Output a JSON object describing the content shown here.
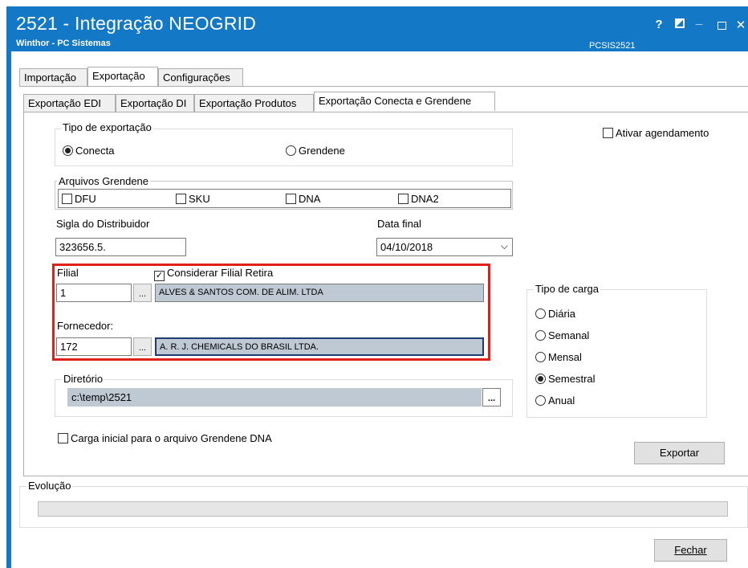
{
  "window": {
    "title": "2521 - Integração NEOGRID",
    "subtitle": "Winthor - PC Sistemas",
    "code": "PCSIS2521",
    "help_label": "?"
  },
  "tabs_main": [
    "Importação",
    "Exportação",
    "Configurações"
  ],
  "tabs_export": [
    "Exportação EDI",
    "Exportação DI",
    "Exportação Produtos",
    "Exportação Conecta e Grendene"
  ],
  "tipo_exportacao": {
    "label": "Tipo de exportação",
    "options": [
      "Conecta",
      "Grendene"
    ],
    "selected": "Conecta"
  },
  "ativar_agendamento": {
    "label": "Ativar agendamento",
    "checked": false
  },
  "arquivos_grendene": {
    "label": "Arquivos Grendene",
    "items": [
      {
        "label": "DFU",
        "checked": false
      },
      {
        "label": "SKU",
        "checked": false
      },
      {
        "label": "DNA",
        "checked": false
      },
      {
        "label": "DNA2",
        "checked": false
      }
    ]
  },
  "sigla_distribuidor": {
    "label": "Sigla do Distribuidor",
    "value": "323656.5."
  },
  "data_final": {
    "label": "Data final",
    "value": "04/10/2018"
  },
  "filial": {
    "label": "Filial",
    "code": "1",
    "name": "ALVES & SANTOS COM. DE ALIM. LTDA",
    "considerar_label": "Considerar Filial Retira",
    "considerar_checked": true
  },
  "fornecedor": {
    "label": "Fornecedor:",
    "code": "172",
    "name": "A. R. J. CHEMICALS DO BRASIL LTDA."
  },
  "lookup_button_label": "...",
  "tipo_carga": {
    "label": "Tipo de carga",
    "options": [
      "Diária",
      "Semanal",
      "Mensal",
      "Semestral",
      "Anual"
    ],
    "selected": "Semestral"
  },
  "diretorio": {
    "label": "Diretório",
    "value": "c:\\temp\\2521",
    "browse_label": "..."
  },
  "carga_inicial": {
    "label": "Carga inicial para o arquivo Grendene DNA",
    "checked": false
  },
  "buttons": {
    "exportar": "Exportar",
    "fechar": "Fechar"
  },
  "evolucao": {
    "label": "Evolução",
    "progress": 0
  },
  "colors": {
    "titlebar": "#1378c6",
    "highlight": "#e0201b",
    "readonly_field": "#bfc9d3"
  }
}
